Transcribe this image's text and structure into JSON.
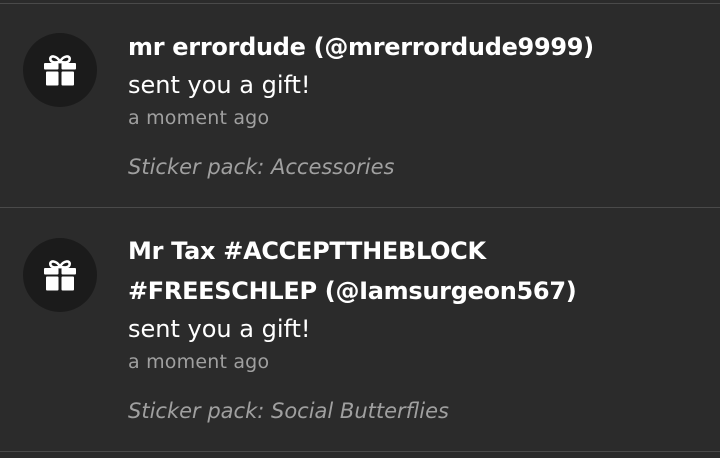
{
  "notifications": [
    {
      "icon": "gift-icon",
      "sender": "mr errordude (@mrerrordude9999)",
      "message": "sent you a gift!",
      "time": "a moment ago",
      "detail": "Sticker pack: Accessories"
    },
    {
      "icon": "gift-icon",
      "sender_line1": "Mr Tax #ACCEPTTHEBLOCK",
      "sender_line2": "#FREESCHLEP (@Iamsurgeon567)",
      "message": "sent you a gift!",
      "time": "a moment ago",
      "detail": "Sticker pack: Social Butterflies"
    }
  ],
  "colors": {
    "background": "#2b2b2b",
    "icon_background": "#1b1b1b",
    "primary_text": "#ffffff",
    "secondary_text": "#a0a0a0",
    "divider": "#4a4a4a"
  }
}
